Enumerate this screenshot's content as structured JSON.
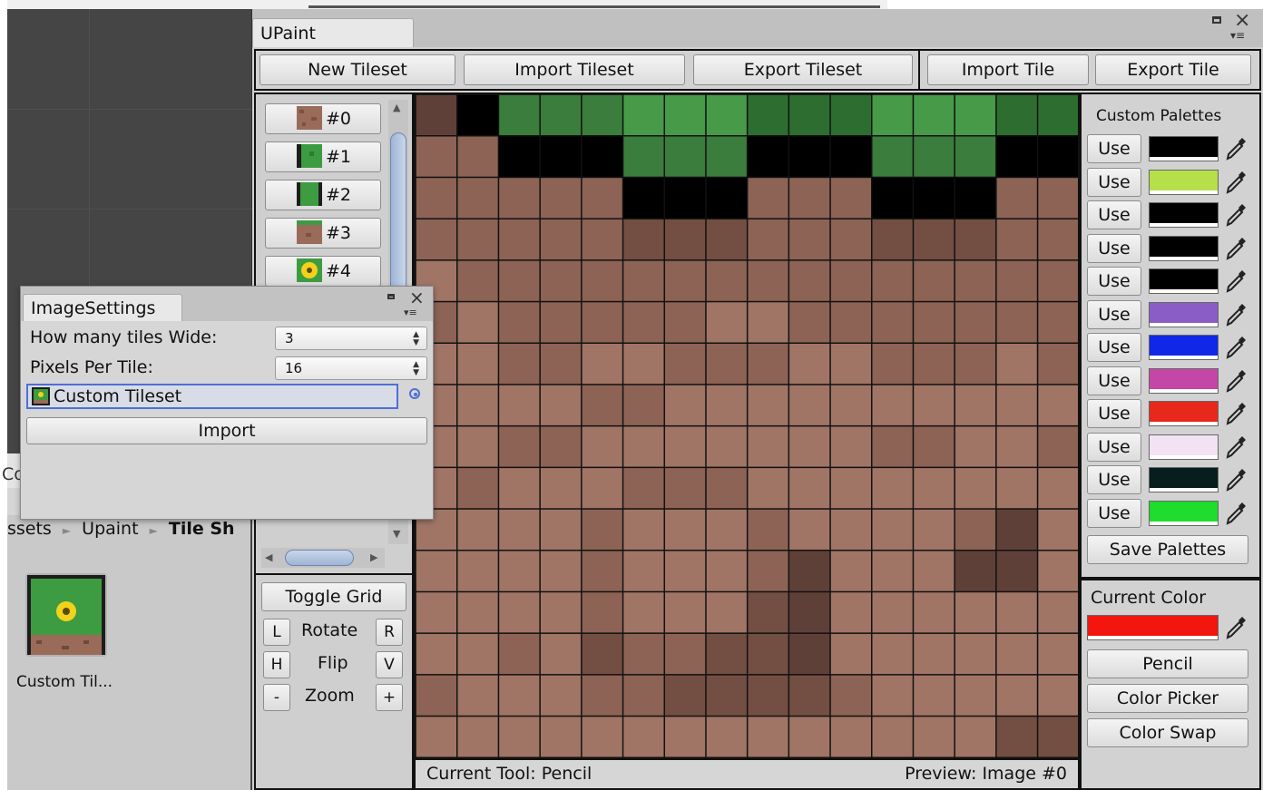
{
  "window": {
    "title": "UPaint"
  },
  "toolbar": {
    "new_tileset": "New Tileset",
    "import_tileset": "Import Tileset",
    "export_tileset": "Export Tileset",
    "import_tile": "Import Tile",
    "export_tile": "Export Tile"
  },
  "tiles": [
    {
      "label": "#0",
      "kind": "dirt-tile"
    },
    {
      "label": "#1",
      "kind": "grass-left-tile"
    },
    {
      "label": "#2",
      "kind": "grass-edge-tile"
    },
    {
      "label": "#3",
      "kind": "dirt-top-tile"
    },
    {
      "label": "#4",
      "kind": "flower-tile"
    }
  ],
  "tools": {
    "toggle_grid": "Toggle Grid",
    "rotate": {
      "label": "Rotate",
      "left": "L",
      "right": "R"
    },
    "flip": {
      "label": "Flip",
      "h": "H",
      "v": "V"
    },
    "zoom": {
      "label": "Zoom",
      "minus": "-",
      "plus": "+"
    }
  },
  "palettes": {
    "title": "Custom Palettes",
    "use_label": "Use",
    "colors": [
      "#000000",
      "#b5e04a",
      "#000000",
      "#000000",
      "#000000",
      "#8a5cc6",
      "#1027e8",
      "#c447a6",
      "#e8281c",
      "#f2e2f4",
      "#071d1e",
      "#20dc2c"
    ],
    "save_label": "Save Palettes"
  },
  "current": {
    "title": "Current Color",
    "color": "#f2160e",
    "pencil": "Pencil",
    "color_picker": "Color Picker",
    "color_swap": "Color Swap"
  },
  "status": {
    "tool": "Current Tool: Pencil",
    "preview": "Preview: Image #0"
  },
  "image_settings": {
    "title": "ImageSettings",
    "tiles_wide_label": "How many tiles Wide:",
    "tiles_wide_value": "3",
    "pixels_per_tile_label": "Pixels Per Tile:",
    "pixels_per_tile_value": "16",
    "tileset_field": "Custom Tileset",
    "import_button": "Import"
  },
  "project": {
    "breadcrumb": [
      "ssets",
      "Upaint",
      "Tile Sh"
    ],
    "asset_name": "Custom Til...",
    "partial_label": "Co"
  },
  "grid": {
    "palette": {
      "k": "#000000",
      "A": "#a07566",
      "B": "#8c6354",
      "C": "#734e43",
      "D": "#5f4038",
      "E": "#3a7d3c",
      "F": "#469a48",
      "G": "#2d6e30"
    },
    "rows": [
      "DkEEEFFFGGGFFFGG",
      "BBkkkEEEkkkEEEkk",
      "BBBBBkkkBBBkkkBB",
      "BBBBBCCCBBBCCCBB",
      "ABBBBBBBBBBBBBBB",
      "BABBBBBAABBBBBBB",
      "AABBAABBBAABBBAB",
      "AAAABBAAAAAAAAAA",
      "AABBAAAAAAABBAAB",
      "ABAAABBBAAAAAAAA",
      "AAAABAAABAAAABDA",
      "AAAABAAABDAAADDA",
      "AAAABAAACDAAAAAA",
      "AABACBBCCDAAAAAA",
      "BAAABBCCCCBAAAAA",
      "AAAAAAAAAAAAAACC"
    ]
  }
}
